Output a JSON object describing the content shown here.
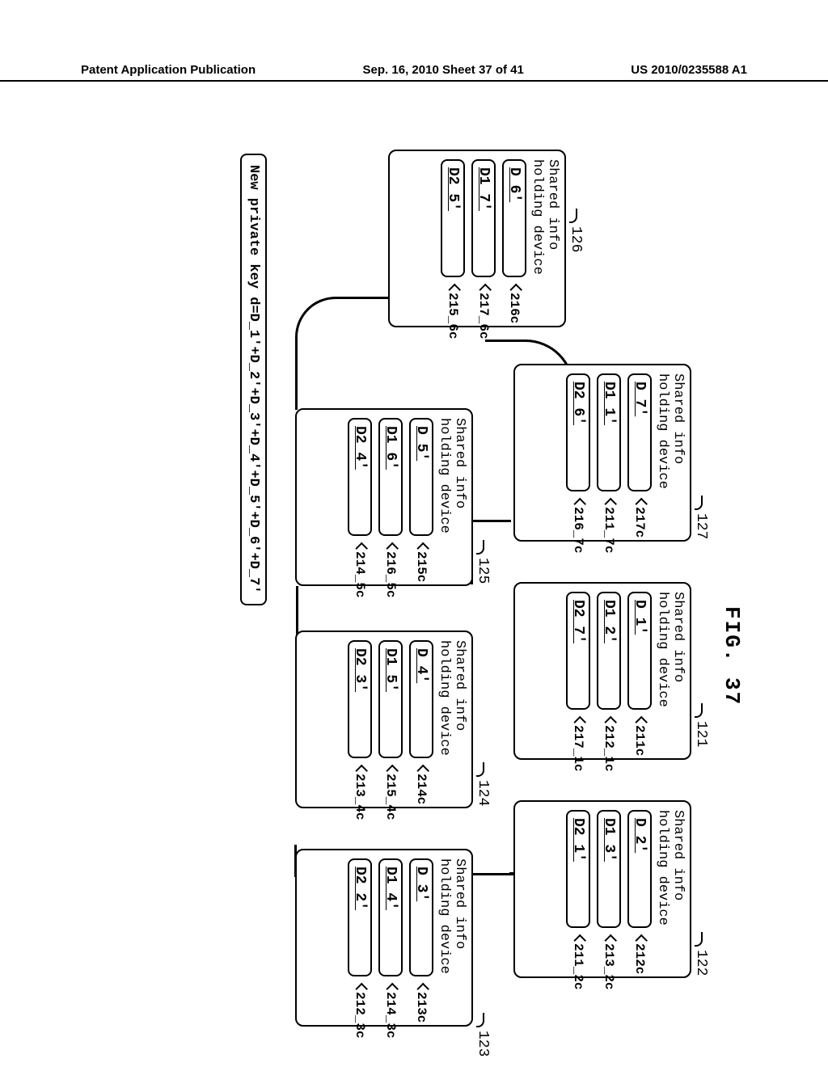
{
  "header": {
    "left": "Patent Application Publication",
    "mid": "Sep. 16, 2010  Sheet 37 of 41",
    "right": "US 2010/0235588 A1"
  },
  "figure_label": "FIG. 37",
  "devices": {
    "d126": {
      "ref": "126",
      "title1": "Shared info",
      "title2": "holding device",
      "row1": {
        "val": "D_6'",
        "tag": "216c"
      },
      "row2": {
        "val": "D1_7'",
        "tag": "217_6c"
      },
      "row3": {
        "val": "D2_5'",
        "tag": "215_6c"
      }
    },
    "d127": {
      "ref": "127",
      "title1": "Shared info",
      "title2": "holding device",
      "row1": {
        "val": "D_7'",
        "tag": "217c"
      },
      "row2": {
        "val": "D1_1'",
        "tag": "211_7c"
      },
      "row3": {
        "val": "D2_6'",
        "tag": "216_7c"
      }
    },
    "d121": {
      "ref": "121",
      "title1": "Shared info",
      "title2": "holding device",
      "row1": {
        "val": "D_1'",
        "tag": "211c"
      },
      "row2": {
        "val": "D1_2'",
        "tag": "212_1c"
      },
      "row3": {
        "val": "D2_7'",
        "tag": "217_1c"
      }
    },
    "d122": {
      "ref": "122",
      "title1": "Shared info",
      "title2": "holding device",
      "row1": {
        "val": "D_2'",
        "tag": "212c"
      },
      "row2": {
        "val": "D1_3'",
        "tag": "213_2c"
      },
      "row3": {
        "val": "D2_1'",
        "tag": "211_2c"
      }
    },
    "d125": {
      "ref": "125",
      "title1": "Shared info",
      "title2": "holding device",
      "row1": {
        "val": "D_5'",
        "tag": "215c"
      },
      "row2": {
        "val": "D1_6'",
        "tag": "216_5c"
      },
      "row3": {
        "val": "D2_4'",
        "tag": "214_5c"
      }
    },
    "d124": {
      "ref": "124",
      "title1": "Shared info",
      "title2": "holding device",
      "row1": {
        "val": "D_4'",
        "tag": "214c"
      },
      "row2": {
        "val": "D1_5'",
        "tag": "215_4c"
      },
      "row3": {
        "val": "D2_3'",
        "tag": "213_4c"
      }
    },
    "d123": {
      "ref": "123",
      "title1": "Shared info",
      "title2": "holding device",
      "row1": {
        "val": "D_3'",
        "tag": "213c"
      },
      "row2": {
        "val": "D1_4'",
        "tag": "214_3c"
      },
      "row3": {
        "val": "D2_2'",
        "tag": "212_3c"
      }
    }
  },
  "footer_equation": "New private key d=D_1'+D_2'+D_3'+D_4'+D_5'+D_6'+D_7'"
}
